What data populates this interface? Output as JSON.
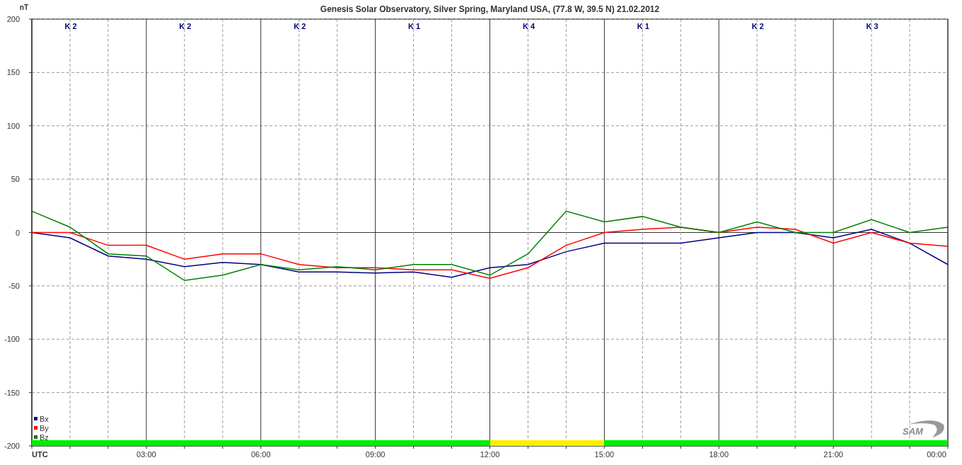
{
  "chart": {
    "ylabel": "nT",
    "logo": "SAM",
    "k_indices": [
      {
        "label": "K 2",
        "color": "#00ee00"
      },
      {
        "label": "K 2",
        "color": "#00ee00"
      },
      {
        "label": "K 2",
        "color": "#00ee00"
      },
      {
        "label": "K 1",
        "color": "#00ee00"
      },
      {
        "label": "K 4",
        "color": "#ffee00"
      },
      {
        "label": "K 1",
        "color": "#00ee00"
      },
      {
        "label": "K 2",
        "color": "#00ee00"
      },
      {
        "label": "K 3",
        "color": "#00ee00"
      }
    ],
    "chart_data": {
      "type": "line",
      "title": "Genesis Solar Observatory, Silver Spring, Maryland USA, (77.8 W, 39.5 N)  21.02.2012",
      "grid": true,
      "legend": true,
      "x": [
        0,
        1,
        2,
        3,
        4,
        5,
        6,
        7,
        8,
        9,
        10,
        11,
        12,
        13,
        14,
        15,
        16,
        17,
        18,
        19,
        20,
        21,
        22,
        23,
        24
      ],
      "xlim": [
        0,
        24
      ],
      "ylim": [
        -200,
        200
      ],
      "xticks": [
        {
          "value": 0,
          "label": "UTC"
        },
        {
          "value": 3,
          "label": "03:00"
        },
        {
          "value": 6,
          "label": "06:00"
        },
        {
          "value": 9,
          "label": "09:00"
        },
        {
          "value": 12,
          "label": "12:00"
        },
        {
          "value": 15,
          "label": "15:00"
        },
        {
          "value": 18,
          "label": "18:00"
        },
        {
          "value": 21,
          "label": "21:00"
        },
        {
          "value": 24,
          "label": "00:00"
        }
      ],
      "yticks": [
        -200,
        -150,
        -100,
        -50,
        0,
        50,
        100,
        150,
        200
      ],
      "series": [
        {
          "name": "Bx",
          "color": "#000080",
          "values": [
            0,
            -5,
            -22,
            -25,
            -32,
            -28,
            -30,
            -37,
            -37,
            -38,
            -37,
            -42,
            -33,
            -30,
            -18,
            -10,
            -10,
            -10,
            -5,
            0,
            0,
            -5,
            3,
            -10,
            -30
          ]
        },
        {
          "name": "By",
          "color": "#ff0000",
          "values": [
            0,
            0,
            -12,
            -12,
            -25,
            -20,
            -20,
            -30,
            -33,
            -33,
            -35,
            -35,
            -43,
            -33,
            -12,
            0,
            3,
            5,
            0,
            5,
            3,
            -10,
            0,
            -10,
            -13
          ]
        },
        {
          "name": "Bz",
          "color": "#008000",
          "values": [
            20,
            5,
            -20,
            -22,
            -45,
            -40,
            -30,
            -35,
            -32,
            -35,
            -30,
            -30,
            -40,
            -20,
            20,
            10,
            15,
            5,
            0,
            10,
            0,
            0,
            12,
            0,
            5
          ]
        }
      ]
    }
  }
}
